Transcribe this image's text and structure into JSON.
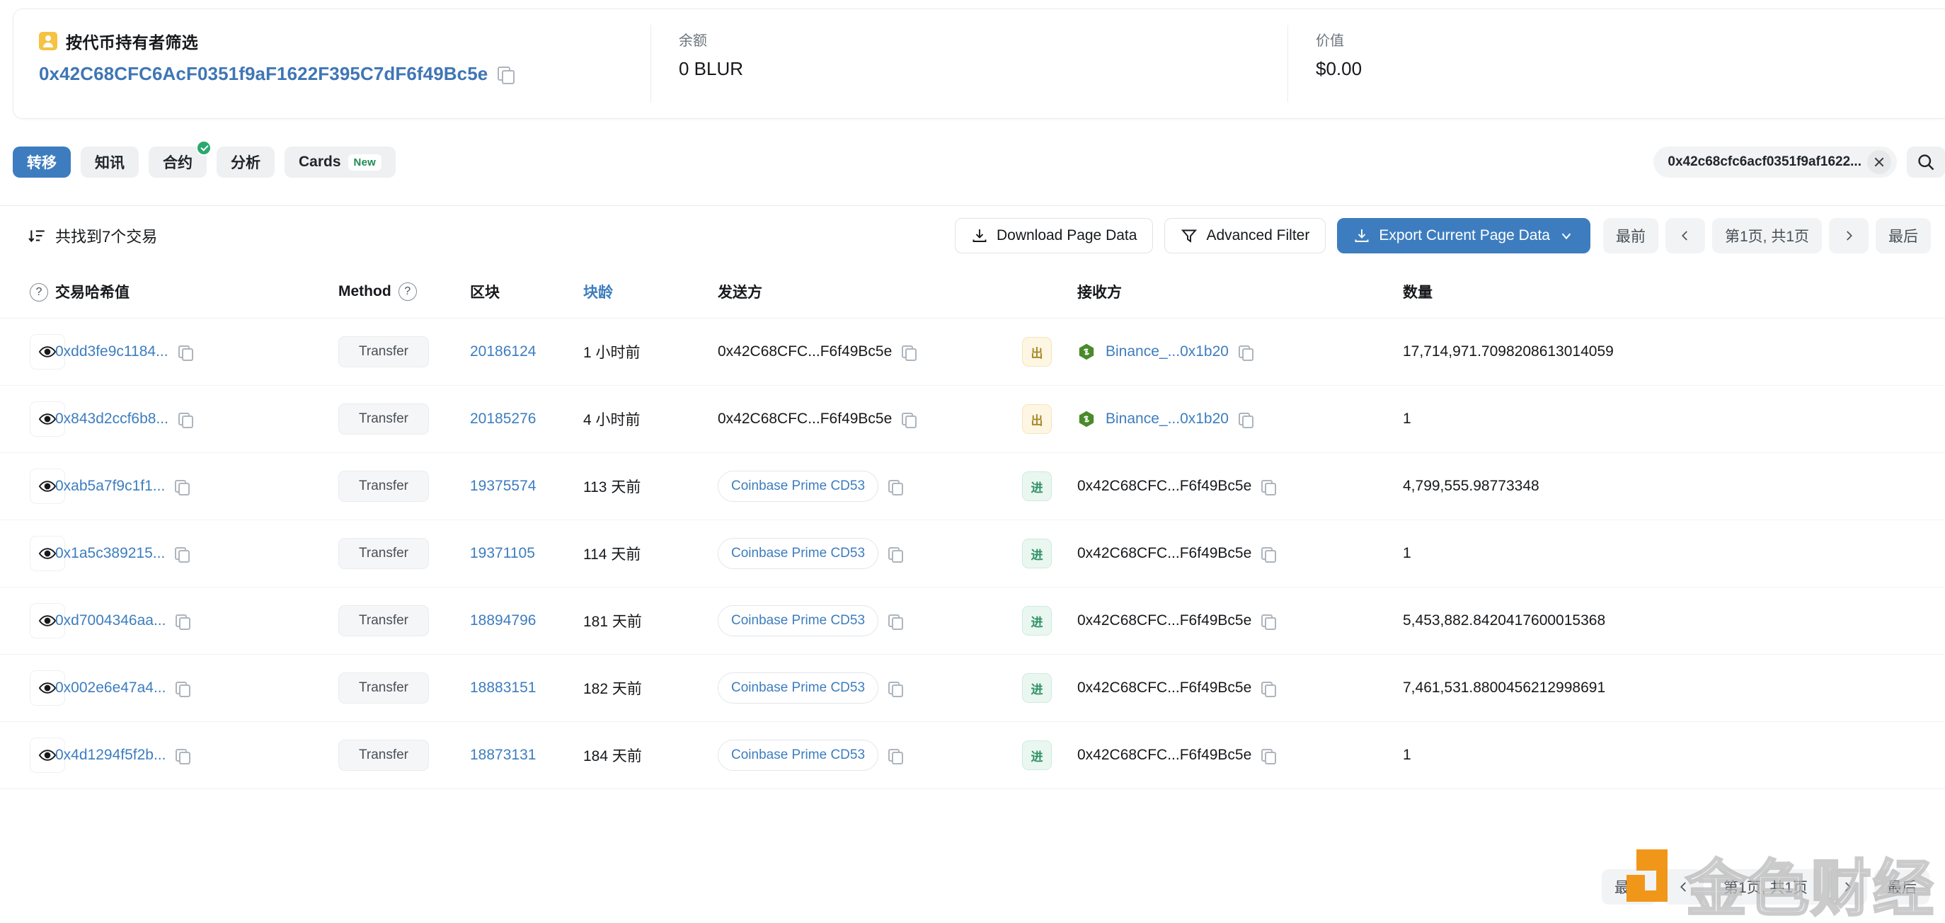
{
  "summary": {
    "holder_filter_label": "按代币持有者筛选",
    "holder_icon": "address-book-icon",
    "holder_address": "0x42C68CFC6AcF0351f9aF1622F395C7dF6f49Bc5e",
    "balance_label": "余额",
    "balance_value": "0 BLUR",
    "value_label": "价值",
    "value_value": "$0.00"
  },
  "tabs": [
    {
      "label": "转移",
      "active": true,
      "badge": null,
      "check": false
    },
    {
      "label": "知讯",
      "active": false,
      "badge": null,
      "check": false
    },
    {
      "label": "合约",
      "active": false,
      "badge": null,
      "check": true
    },
    {
      "label": "分析",
      "active": false,
      "badge": null,
      "check": false
    },
    {
      "label": "Cards",
      "active": false,
      "badge": "New",
      "check": false
    }
  ],
  "search": {
    "value": "0x42c68cfc6acf0351f9af1622...",
    "clear_icon": "close-icon",
    "search_icon": "search-icon"
  },
  "toolbar": {
    "found_text": "共找到7个交易",
    "sort_icon": "sort-descending-icon",
    "download_label": "Download Page Data",
    "download_icon": "download-icon",
    "advanced_filter_label": "Advanced Filter",
    "filter_icon": "funnel-icon",
    "export_label": "Export Current Page Data",
    "export_icon": "download-icon",
    "export_caret": "chevron-down-icon"
  },
  "pagination": {
    "first": "最前",
    "prev": "‹",
    "info": "第1页, 共1页",
    "next": "›",
    "last": "最后"
  },
  "table": {
    "headers": {
      "hint": "?",
      "hash": "交易哈希值",
      "method": "Method",
      "method_hint": "?",
      "block": "区块",
      "age": "块龄",
      "from": "发送方",
      "to": "接收方",
      "amount": "数量"
    },
    "rows": [
      {
        "eye_icon": "eye-icon",
        "hash": "0xdd3fe9c1184...",
        "method": "Transfer",
        "block": "20186124",
        "age": "1 小时前",
        "from": "0x42C68CFC...F6f49Bc5e",
        "from_is_chip": false,
        "direction": "出",
        "direction_type": "out",
        "to": "Binance_...0x1b20",
        "to_is_link": true,
        "to_has_logo": true,
        "amount": "17,714,971.7098208613014059"
      },
      {
        "eye_icon": "eye-icon",
        "hash": "0x843d2ccf6b8...",
        "method": "Transfer",
        "block": "20185276",
        "age": "4 小时前",
        "from": "0x42C68CFC...F6f49Bc5e",
        "from_is_chip": false,
        "direction": "出",
        "direction_type": "out",
        "to": "Binance_...0x1b20",
        "to_is_link": true,
        "to_has_logo": true,
        "amount": "1"
      },
      {
        "eye_icon": "eye-icon",
        "hash": "0xab5a7f9c1f1...",
        "method": "Transfer",
        "block": "19375574",
        "age": "113 天前",
        "from": "Coinbase Prime CD53",
        "from_is_chip": true,
        "direction": "进",
        "direction_type": "in",
        "to": "0x42C68CFC...F6f49Bc5e",
        "to_is_link": false,
        "to_has_logo": false,
        "amount": "4,799,555.98773348"
      },
      {
        "eye_icon": "eye-icon",
        "hash": "0x1a5c389215...",
        "method": "Transfer",
        "block": "19371105",
        "age": "114 天前",
        "from": "Coinbase Prime CD53",
        "from_is_chip": true,
        "direction": "进",
        "direction_type": "in",
        "to": "0x42C68CFC...F6f49Bc5e",
        "to_is_link": false,
        "to_has_logo": false,
        "amount": "1"
      },
      {
        "eye_icon": "eye-icon",
        "hash": "0xd7004346aa...",
        "method": "Transfer",
        "block": "18894796",
        "age": "181 天前",
        "from": "Coinbase Prime CD53",
        "from_is_chip": true,
        "direction": "进",
        "direction_type": "in",
        "to": "0x42C68CFC...F6f49Bc5e",
        "to_is_link": false,
        "to_has_logo": false,
        "amount": "5,453,882.8420417600015368"
      },
      {
        "eye_icon": "eye-icon",
        "hash": "0x002e6e47a4...",
        "method": "Transfer",
        "block": "18883151",
        "age": "182 天前",
        "from": "Coinbase Prime CD53",
        "from_is_chip": true,
        "direction": "进",
        "direction_type": "in",
        "to": "0x42C68CFC...F6f49Bc5e",
        "to_is_link": false,
        "to_has_logo": false,
        "amount": "7,461,531.8800456212998691"
      },
      {
        "eye_icon": "eye-icon",
        "hash": "0x4d1294f5f2b...",
        "method": "Transfer",
        "block": "18873131",
        "age": "184 天前",
        "from": "Coinbase Prime CD53",
        "from_is_chip": true,
        "direction": "进",
        "direction_type": "in",
        "to": "0x42C68CFC...F6f49Bc5e",
        "to_is_link": false,
        "to_has_logo": false,
        "amount": "1"
      }
    ]
  },
  "watermark": {
    "text": "金色财经"
  },
  "colors": {
    "accent_blue": "#3d7dbf",
    "link_blue": "#3d7dbf",
    "out_badge": "#a98a2c",
    "in_badge": "#2f9167",
    "holder_icon": "#f5c242",
    "watermark_orange": "#f0971a"
  }
}
